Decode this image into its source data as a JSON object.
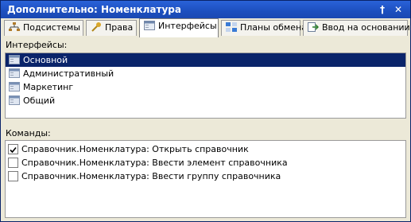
{
  "window": {
    "title": "Дополнительно: Номенклатура",
    "buttons": [
      "†",
      "×"
    ]
  },
  "tabs": [
    {
      "label": "Подсистемы",
      "icon": "subsystems-icon",
      "active": false
    },
    {
      "label": "Права",
      "icon": "rights-icon",
      "active": false
    },
    {
      "label": "Интерфейсы",
      "icon": "interfaces-icon",
      "active": true
    },
    {
      "label": "Планы обмена",
      "icon": "exchange-plans-icon",
      "active": false
    },
    {
      "label": "Ввод на основании",
      "icon": "input-based-icon",
      "active": false
    }
  ],
  "interfaces": {
    "label": "Интерфейсы:",
    "items": [
      {
        "label": "Основной",
        "selected": true
      },
      {
        "label": "Административный",
        "selected": false
      },
      {
        "label": "Маркетинг",
        "selected": false
      },
      {
        "label": "Общий",
        "selected": false
      }
    ]
  },
  "commands": {
    "label": "Команды:",
    "items": [
      {
        "label": "Справочник.Номенклатура: Открыть справочник",
        "checked": true
      },
      {
        "label": "Справочник.Номенклатура: Ввести элемент справочника",
        "checked": false
      },
      {
        "label": "Справочник.Номенклатура: Ввести группу справочника",
        "checked": false
      }
    ]
  },
  "colors": {
    "selection": "#0a246a",
    "title_bar": "#1c4fbf"
  }
}
